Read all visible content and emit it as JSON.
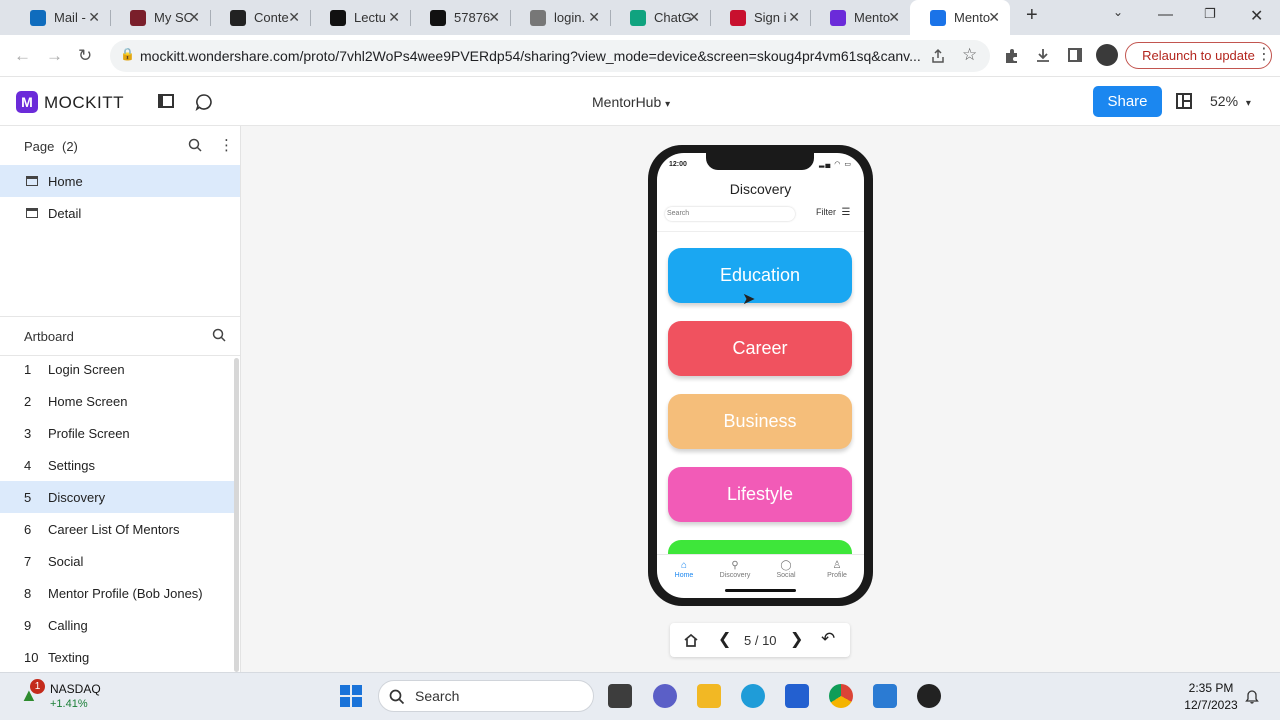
{
  "browser": {
    "tabs": [
      {
        "title": "Mail -",
        "favicon": "outlook-icon",
        "color": "#0f6cbd"
      },
      {
        "title": "My SC",
        "favicon": "school-icon",
        "color": "#7a1f2b"
      },
      {
        "title": "Conte",
        "favicon": "chart-icon",
        "color": "#222222"
      },
      {
        "title": "Lectu",
        "favicon": "blackboard-icon",
        "color": "#111111"
      },
      {
        "title": "57876",
        "favicon": "blackboard-icon",
        "color": "#111111"
      },
      {
        "title": "login.",
        "favicon": "globe-icon",
        "color": "#777777"
      },
      {
        "title": "ChatG",
        "favicon": "chatgpt-icon",
        "color": "#10a37f"
      },
      {
        "title": "Sign i",
        "favicon": "pinterest-icon",
        "color": "#c8102e"
      },
      {
        "title": "Mento",
        "favicon": "mockitt-icon",
        "color": "#6b2bd9"
      },
      {
        "title": "Mento",
        "favicon": "play-icon",
        "color": "#1a73e8",
        "active": true
      }
    ],
    "url": "mockitt.wondershare.com/proto/7vhl2WoPs4wee9PVERdp54/sharing?view_mode=device&screen=skoug4pr4vm61sq&canv...",
    "relaunch_label": "Relaunch to update"
  },
  "app": {
    "brand": "MOCKITT",
    "project_name": "MentorHub",
    "share_label": "Share",
    "zoom": "52%",
    "brand_color": "#6b2bd9",
    "accent": "#1b87f0"
  },
  "sidebar": {
    "page_header": "Page",
    "page_count": "(2)",
    "pages": [
      {
        "label": "Home",
        "selected": true
      },
      {
        "label": "Detail",
        "selected": false
      }
    ],
    "artboard_header": "Artboard",
    "artboards": [
      {
        "num": "1",
        "label": "Login Screen"
      },
      {
        "num": "2",
        "label": "Home Screen"
      },
      {
        "num": "3",
        "label": "Profile Screen"
      },
      {
        "num": "4",
        "label": "Settings"
      },
      {
        "num": "5",
        "label": "Discovery",
        "selected": true
      },
      {
        "num": "6",
        "label": "Career List Of Mentors"
      },
      {
        "num": "7",
        "label": "Social"
      },
      {
        "num": "8",
        "label": "Mentor Profile (Bob Jones)"
      },
      {
        "num": "9",
        "label": "Calling"
      },
      {
        "num": "10",
        "label": "Texting"
      }
    ]
  },
  "phone": {
    "time": "12:00",
    "title": "Discovery",
    "search_placeholder": "Search",
    "filter_label": "Filter",
    "categories": [
      {
        "label": "Education",
        "color": "#1aa7f2"
      },
      {
        "label": "Career",
        "color": "#f0525f"
      },
      {
        "label": "Business",
        "color": "#f5be7a"
      },
      {
        "label": "Lifestyle",
        "color": "#f25bb7"
      },
      {
        "label": "",
        "color": "#3ee63a"
      }
    ],
    "tabs": [
      {
        "label": "Home",
        "icon": "home-icon",
        "active": true
      },
      {
        "label": "Discovery",
        "icon": "search-icon"
      },
      {
        "label": "Social",
        "icon": "chat-bubble-icon"
      },
      {
        "label": "Profile",
        "icon": "person-icon"
      }
    ]
  },
  "pager": {
    "current": "5",
    "total": "10",
    "text": "5 / 10"
  },
  "taskbar": {
    "stock_name": "NASDAQ",
    "stock_change": "+1.41%",
    "notification_count": "1",
    "search_label": "Search",
    "time": "2:35 PM",
    "date": "12/7/2023"
  }
}
